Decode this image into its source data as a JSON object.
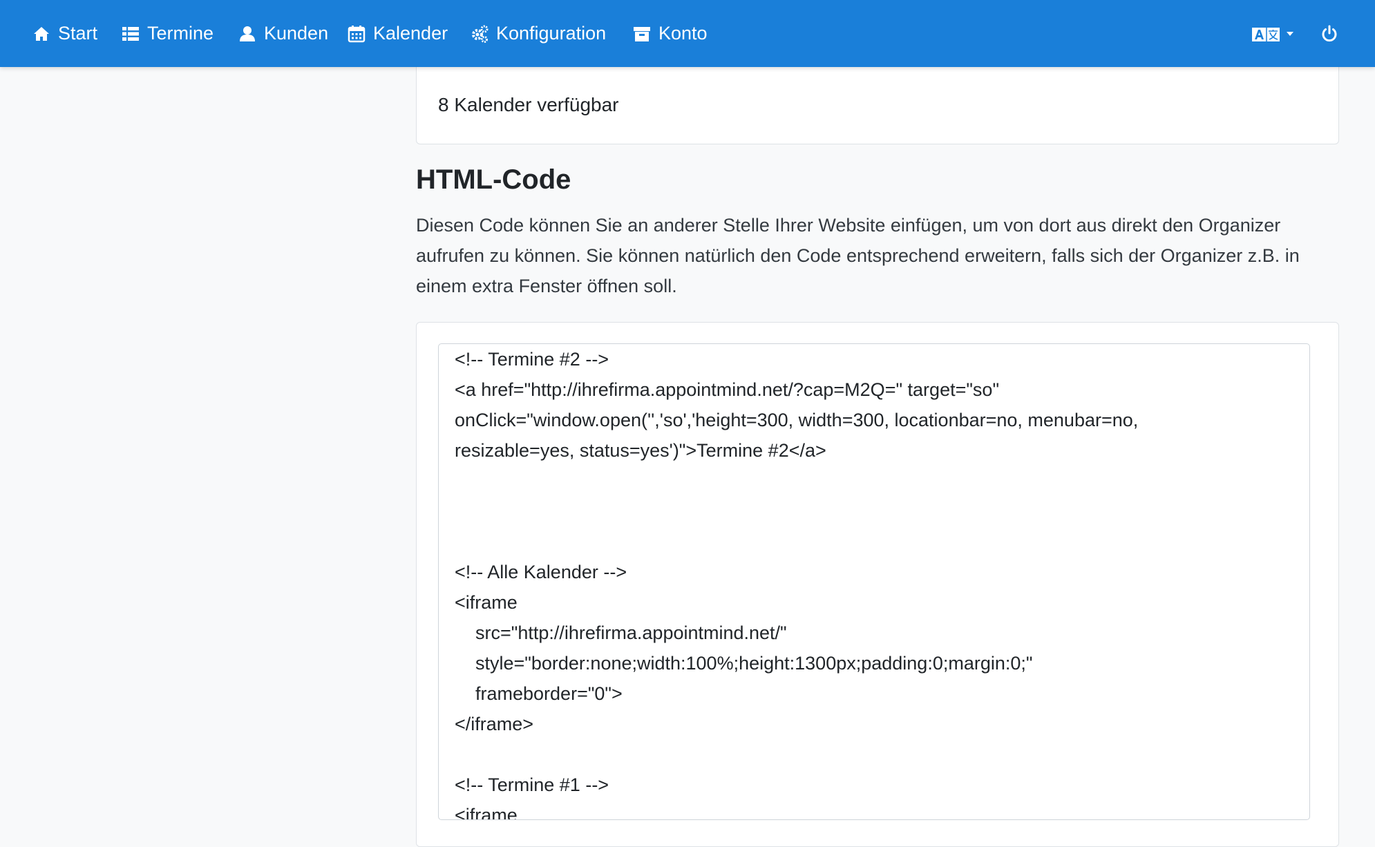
{
  "nav": {
    "items": [
      {
        "label": "Start",
        "icon": "home-icon"
      },
      {
        "label": "Termine",
        "icon": "list-icon"
      },
      {
        "label": "Kunden",
        "icon": "user-icon"
      },
      {
        "label": "Kalender",
        "icon": "calendar-icon"
      },
      {
        "label": "Konfiguration",
        "icon": "cogs-icon"
      },
      {
        "label": "Konto",
        "icon": "archive-icon"
      }
    ],
    "language_icon": "translate-icon",
    "power_icon": "power-icon",
    "background": "#1a7fd9"
  },
  "calendar_card": {
    "text": "8 Kalender verfügbar"
  },
  "html_section": {
    "title": "HTML-Code",
    "description": "Diesen Code können Sie an anderer Stelle Ihrer Website einfügen, um von dort aus direkt den Organizer aufrufen zu können. Sie können natürlich den Code entsprechend erweitern, falls sich der Organizer z.B. in einem extra Fenster öffnen soll.",
    "code": "<!-- Termine #2 -->\n<a href=\"http://ihrefirma.appointmind.net/?cap=M2Q=\" target=\"so\"\nonClick=\"window.open('','so','height=300, width=300, locationbar=no, menubar=no,\nresizable=yes, status=yes')\">Termine #2</a>\n\n\n\n<!-- Alle Kalender -->\n<iframe\n    src=\"http://ihrefirma.appointmind.net/\"\n    style=\"border:none;width:100%;height:1300px;padding:0;margin:0;\"\n    frameborder=\"0\">\n</iframe>\n\n<!-- Termine #1 -->\n<iframe"
  }
}
